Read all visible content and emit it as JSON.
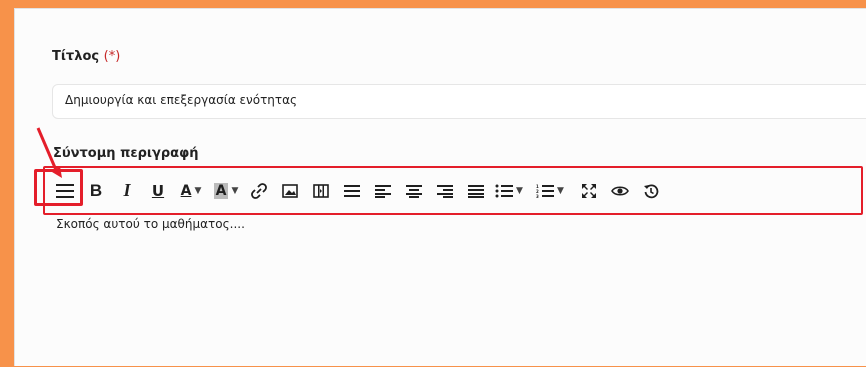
{
  "form": {
    "title_label": "Τίτλος",
    "required_marker": "(*)",
    "title_value": "Δημιουργία και επεξεργασία ενότητας",
    "description_label": "Σύντομη περιγραφή",
    "description_value": "Σκοπός αυτού το μαθήματος...."
  },
  "toolbar": {
    "buttons": [
      {
        "name": "source-toggle-icon",
        "glyph": "☰"
      },
      {
        "name": "bold-icon",
        "glyph": "B"
      },
      {
        "name": "italic-icon",
        "glyph": "I"
      },
      {
        "name": "underline-icon",
        "glyph": "U"
      },
      {
        "name": "font-color-icon",
        "glyph": "A"
      },
      {
        "name": "background-color-icon",
        "glyph": "A"
      },
      {
        "name": "link-icon",
        "glyph": "🔗"
      },
      {
        "name": "image-icon",
        "glyph": "▣"
      },
      {
        "name": "video-icon",
        "glyph": "▦"
      },
      {
        "name": "horizontal-rule-icon",
        "glyph": "☰"
      },
      {
        "name": "align-left-icon",
        "glyph": "≡"
      },
      {
        "name": "align-center-icon",
        "glyph": "≡"
      },
      {
        "name": "align-right-icon",
        "glyph": "≡"
      },
      {
        "name": "align-justify-icon",
        "glyph": "≣"
      },
      {
        "name": "bullet-list-icon",
        "glyph": "⁝≡"
      },
      {
        "name": "numbered-list-icon",
        "glyph": "⅓≡"
      },
      {
        "name": "fullscreen-icon",
        "glyph": "⛶"
      },
      {
        "name": "preview-icon",
        "glyph": "👁"
      },
      {
        "name": "history-icon",
        "glyph": "↺"
      }
    ]
  },
  "colors": {
    "background": "#f7924a",
    "highlight": "#e41e2a",
    "required": "#c62828"
  }
}
